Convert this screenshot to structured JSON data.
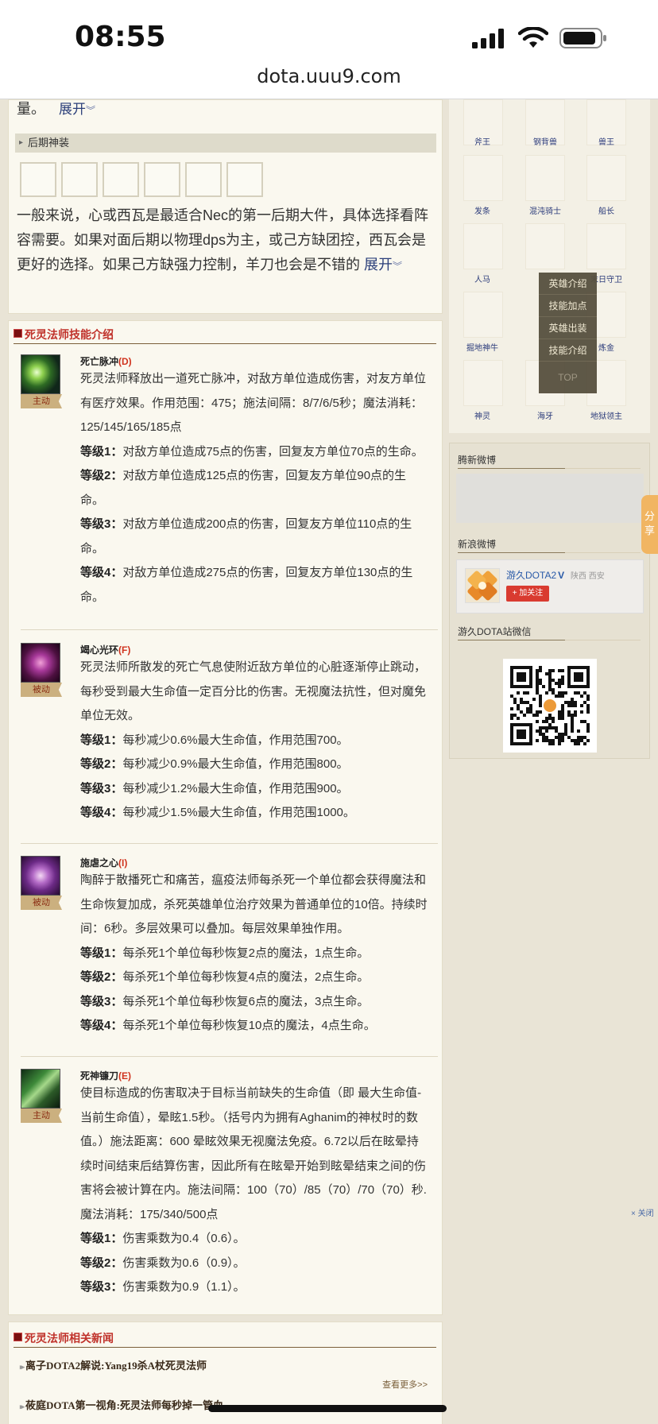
{
  "status": {
    "time": "08:55",
    "url": "dota.uuu9.com"
  },
  "intro": {
    "tail": "量。",
    "expand": "展开"
  },
  "late_items": {
    "title": "后期神装",
    "text": "一般来说，心或西瓦是最适合Nec的第一后期大件，具体选择看阵容需要。如果对面后期以物理dps为主，或己方缺团控，西瓦会是更好的选择。如果己方缺强力控制，羊刀也会是不错的",
    "expand": "展开"
  },
  "skills_section": {
    "title": "死灵法师技能介绍"
  },
  "skills": [
    {
      "name": "死亡脉冲",
      "key": "(D)",
      "tag": "主动",
      "desc": "死灵法师释放出一道死亡脉冲，对敌方单位造成伤害，对友方单位有医疗效果。作用范围：475；施法间隔：8/7/6/5秒；魔法消耗：125/145/165/185点",
      "levels": [
        {
          "label": "等级1：",
          "text": "对敌方单位造成75点的伤害，回复友方单位70点的生命。"
        },
        {
          "label": "等级2：",
          "text": "对敌方单位造成125点的伤害，回复友方单位90点的生命。"
        },
        {
          "label": "等级3：",
          "text": "对敌方单位造成200点的伤害，回复友方单位110点的生命。"
        },
        {
          "label": "等级4：",
          "text": "对敌方单位造成275点的伤害，回复友方单位130点的生命。"
        }
      ]
    },
    {
      "name": "竭心光环",
      "key": "(F)",
      "tag": "被动",
      "desc": "死灵法师所散发的死亡气息使附近敌方单位的心脏逐渐停止跳动，每秒受到最大生命值一定百分比的伤害。无视魔法抗性，但对魔免单位无效。",
      "levels": [
        {
          "label": "等级1：",
          "text": "每秒减少0.6%最大生命值，作用范围700。"
        },
        {
          "label": "等级2：",
          "text": "每秒减少0.9%最大生命值，作用范围800。"
        },
        {
          "label": "等级3：",
          "text": "每秒减少1.2%最大生命值，作用范围900。"
        },
        {
          "label": "等级4：",
          "text": "每秒减少1.5%最大生命值，作用范围1000。"
        }
      ]
    },
    {
      "name": "施虐之心",
      "key": "(I)",
      "tag": "被动",
      "desc": "陶醉于散播死亡和痛苦，瘟疫法师每杀死一个单位都会获得魔法和生命恢复加成，杀死英雄单位治疗效果为普通单位的10倍。持续时间：6秒。多层效果可以叠加。每层效果单独作用。",
      "levels": [
        {
          "label": "等级1：",
          "text": "每杀死1个单位每秒恢复2点的魔法，1点生命。"
        },
        {
          "label": "等级2：",
          "text": "每杀死1个单位每秒恢复4点的魔法，2点生命。"
        },
        {
          "label": "等级3：",
          "text": "每杀死1个单位每秒恢复6点的魔法，3点生命。"
        },
        {
          "label": "等级4：",
          "text": "每杀死1个单位每秒恢复10点的魔法，4点生命。"
        }
      ]
    },
    {
      "name": "死神镰刀",
      "key": "(E)",
      "tag": "主动",
      "desc": "使目标造成的伤害取决于目标当前缺失的生命值（即 最大生命值-当前生命值），晕眩1.5秒。（括号内为拥有Aghanim的神杖时的数值。）施法距离：600 晕眩效果无视魔法免疫。6.72以后在眩晕持续时间结束后结算伤害，因此所有在眩晕开始到眩晕结束之间的伤害将会被计算在内。施法间隔：100（70）/85（70）/70（70）秒.魔法消耗：175/340/500点",
      "levels": [
        {
          "label": "等级1：",
          "text": "伤害乘数为0.4（0.6）。"
        },
        {
          "label": "等级2：",
          "text": "伤害乘数为0.6（0.9）。"
        },
        {
          "label": "等级3：",
          "text": "伤害乘数为0.9（1.1）。"
        }
      ]
    }
  ],
  "news_section": {
    "title": "死灵法师相关新闻",
    "items": [
      "离子DOTA2解说:Yang19杀A杖死灵法师",
      "莜庭DOTA第一视角:死灵法师每秒掉一管血"
    ],
    "more": "查看更多>>"
  },
  "heroes": [
    "斧王",
    "钢背兽",
    "兽王",
    "发条",
    "混沌骑士",
    "船长",
    "人马",
    "末日守卫",
    "掘地神牛",
    "炼金",
    "神灵",
    "海牙",
    "地狱领主"
  ],
  "popup_menu": {
    "items": [
      "英雄介绍",
      "技能加点",
      "英雄出装",
      "技能介绍"
    ],
    "top": "TOP"
  },
  "sidebar": {
    "tencent_weibo": "腾新微博",
    "sina_weibo": "新浪微博",
    "sina_name": "游久DOTA2",
    "sina_location": "陕西 西安",
    "follow": "+ 加关注",
    "wechat": "游久DOTA站微信"
  },
  "share": "分享",
  "close_ad": "× 关闭"
}
